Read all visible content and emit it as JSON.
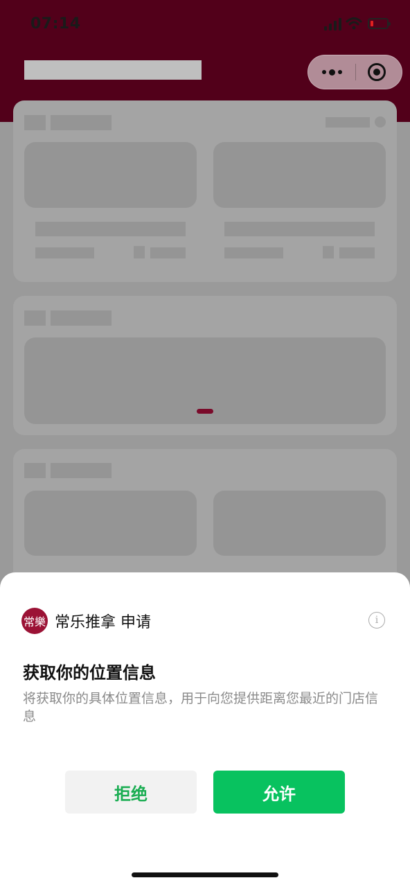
{
  "status_bar": {
    "time": "07:14"
  },
  "colors": {
    "brand": "#52001a",
    "accent_green": "#08c25f",
    "logo": "#9b1235"
  },
  "capsule": {
    "more_icon": "more-dots-icon",
    "close_icon": "target-circle-icon"
  },
  "sheet": {
    "app_logo_text": "常樂",
    "app_name": "常乐推拿 申请",
    "permission_title": "获取你的位置信息",
    "permission_desc": "将获取你的具体位置信息，用于向您提供距离您最近的门店信息",
    "reject_label": "拒绝",
    "allow_label": "允许",
    "info_glyph": "i"
  }
}
